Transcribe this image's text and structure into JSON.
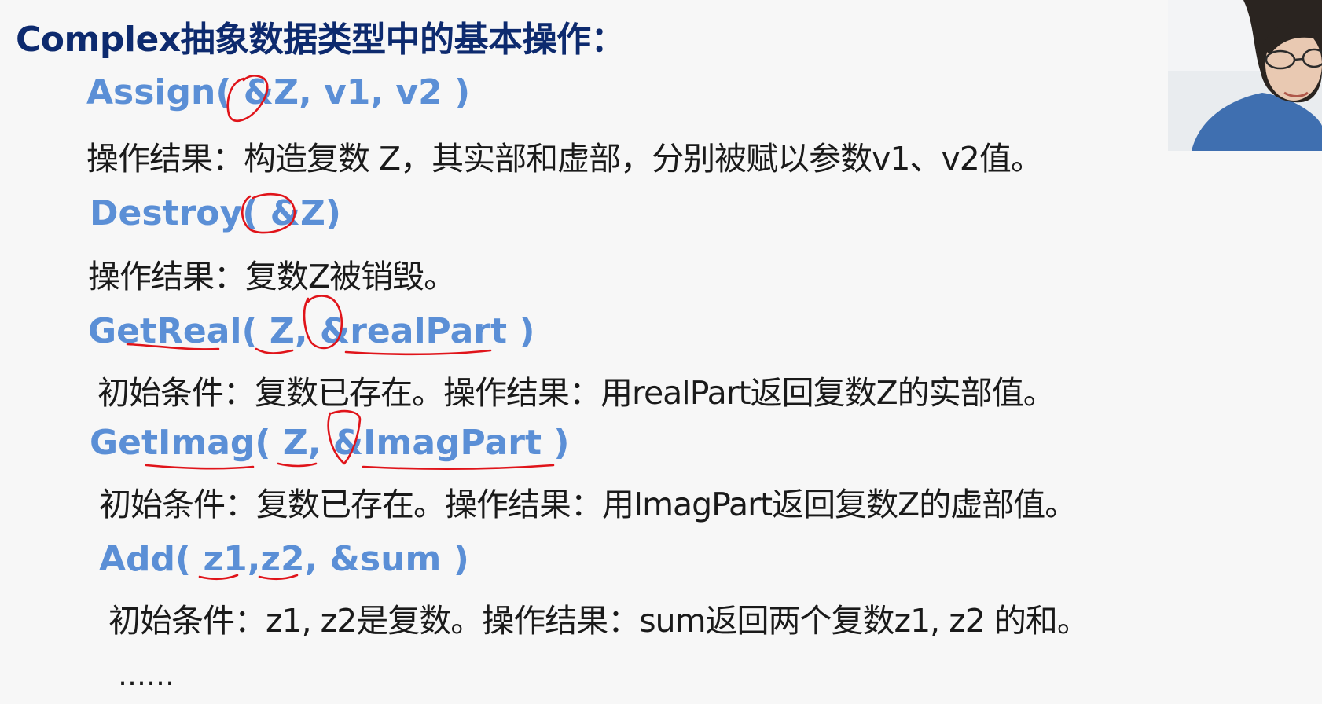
{
  "slide": {
    "title": "Complex抽象数据类型中的基本操作：",
    "operations": [
      {
        "signature": "Assign( &Z, v1, v2 )",
        "description": "操作结果：构造复数 Z，其实部和虚部，分别被赋以参数v1、v2值。"
      },
      {
        "signature": "Destroy( &Z)",
        "description": "操作结果：复数Z被销毁。"
      },
      {
        "signature": "GetReal( Z, &realPart )",
        "description": "初始条件：复数已存在。操作结果：用realPart返回复数Z的实部值。"
      },
      {
        "signature": "GetImag( Z, &ImagPart )",
        "description": "初始条件：复数已存在。操作结果：用ImagPart返回复数Z的虚部值。"
      },
      {
        "signature": "Add( z1,z2, &sum )",
        "description": "初始条件：z1, z2是复数。操作结果：sum返回两个复数z1, z2 的和。"
      }
    ],
    "ellipsis": "……"
  },
  "colors": {
    "title": "#0d2a6e",
    "signature": "#5b8fd6",
    "text": "#1a1a1a",
    "annotation": "#e0141a",
    "background": "#f7f7f7"
  }
}
